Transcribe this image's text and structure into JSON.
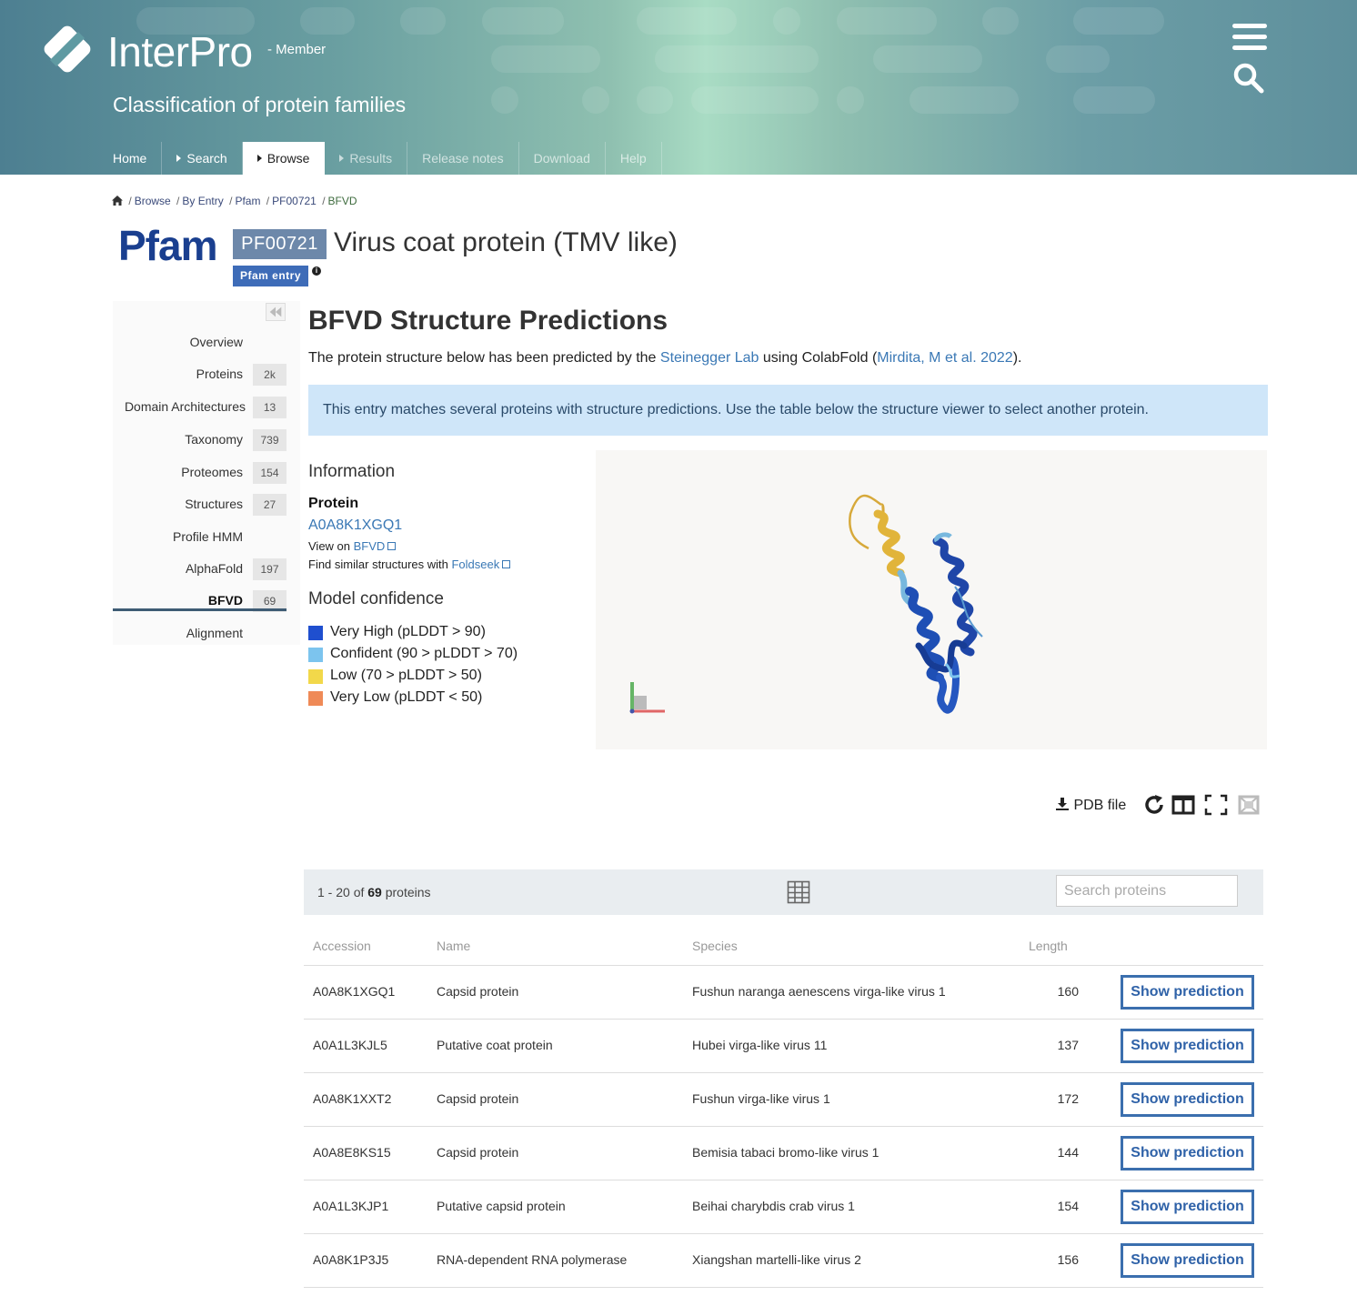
{
  "header": {
    "logo_text": "InterPro",
    "logo_sub": "- Member",
    "tagline": "Classification of protein families",
    "nav": [
      {
        "label": "Home",
        "caret": false,
        "state": "normal"
      },
      {
        "label": "Search",
        "caret": true,
        "state": "normal"
      },
      {
        "label": "Browse",
        "caret": true,
        "state": "active"
      },
      {
        "label": "Results",
        "caret": true,
        "state": "faded"
      },
      {
        "label": "Release notes",
        "caret": false,
        "state": "faded"
      },
      {
        "label": "Download",
        "caret": false,
        "state": "faded"
      },
      {
        "label": "Help",
        "caret": false,
        "state": "faded"
      }
    ]
  },
  "breadcrumb": [
    "Browse",
    "By Entry",
    "Pfam",
    "PF00721",
    "BFVD"
  ],
  "entry": {
    "db_logo": "Pfam",
    "accession": "PF00721",
    "type_badge": "Pfam entry",
    "title": "Virus coat protein (TMV like)"
  },
  "sidebar": {
    "items": [
      {
        "label": "Overview",
        "count": ""
      },
      {
        "label": "Proteins",
        "count": "2k"
      },
      {
        "label": "Domain Architectures",
        "count": "13"
      },
      {
        "label": "Taxonomy",
        "count": "739"
      },
      {
        "label": "Proteomes",
        "count": "154"
      },
      {
        "label": "Structures",
        "count": "27"
      },
      {
        "label": "Profile HMM",
        "count": ""
      },
      {
        "label": "AlphaFold",
        "count": "197"
      },
      {
        "label": "BFVD",
        "count": "69"
      },
      {
        "label": "Alignment",
        "count": ""
      }
    ],
    "active": "BFVD"
  },
  "main": {
    "title": "BFVD Structure Predictions",
    "intro_pre": "The protein structure below has been predicted by the ",
    "intro_link1": "Steinegger Lab",
    "intro_mid": " using ColabFold (",
    "intro_link2": "Mirdita, M et al. 2022",
    "intro_post": ").",
    "callout": "This entry matches several proteins with structure predictions. Use the table below the structure viewer to select another protein.",
    "info_heading": "Information",
    "protein_heading": "Protein",
    "protein_accession": "A0A8K1XGQ1",
    "view_on_pre": "View on ",
    "view_on_link": "BFVD",
    "find_similar_pre": "Find similar structures with ",
    "find_similar_link": "Foldseek",
    "model_conf_heading": "Model confidence",
    "legend": [
      {
        "label": "Very High (pLDDT > 90)",
        "color": "#1f4fcf"
      },
      {
        "label": "Confident (90 > pLDDT > 70)",
        "color": "#7cc4ee"
      },
      {
        "label": "Low (70 > pLDDT > 50)",
        "color": "#f2d84a"
      },
      {
        "label": "Very Low (pLDDT < 50)",
        "color": "#ef8a57"
      }
    ],
    "pdb_file": "PDB file"
  },
  "table": {
    "count_pre": "1 - 20 of ",
    "count_total": "69",
    "count_post": " proteins",
    "search_placeholder": "Search proteins",
    "headers": {
      "accession": "Accession",
      "name": "Name",
      "species": "Species",
      "length": "Length"
    },
    "button_label": "Show prediction",
    "rows": [
      {
        "accession": "A0A8K1XGQ1",
        "name": "Capsid protein",
        "species": "Fushun naranga aenescens virga-like virus 1",
        "length": "160"
      },
      {
        "accession": "A0A1L3KJL5",
        "name": "Putative coat protein",
        "species": "Hubei virga-like virus 11",
        "length": "137"
      },
      {
        "accession": "A0A8K1XXT2",
        "name": "Capsid protein",
        "species": "Fushun virga-like virus 1",
        "length": "172"
      },
      {
        "accession": "A0A8E8KS15",
        "name": "Capsid protein",
        "species": "Bemisia tabaci bromo-like virus 1",
        "length": "144"
      },
      {
        "accession": "A0A1L3KJP1",
        "name": "Putative capsid protein",
        "species": "Beihai charybdis crab virus 1",
        "length": "154"
      },
      {
        "accession": "A0A8K1P3J5",
        "name": "RNA-dependent RNA polymerase",
        "species": "Xiangshan martelli-like virus 2",
        "length": "156"
      }
    ]
  }
}
